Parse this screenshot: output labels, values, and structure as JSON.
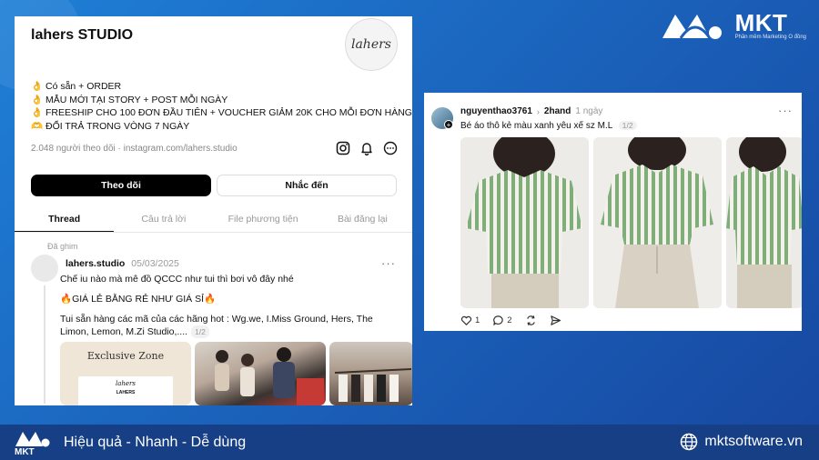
{
  "brand": {
    "name": "MKT",
    "tagline": "Phần mềm Marketing Ô đồng"
  },
  "profile": {
    "name": "lahers STUDIO",
    "avatar_text": "lahers",
    "bio": [
      "👌 Có sẵn + ORDER",
      "👌 MẪU MỚI TẠI STORY + POST MỖI NGÀY",
      "👌 FREESHIP CHO 100 ĐƠN ĐẦU TIÊN + VOUCHER GIẢM 20K CHO MỖI ĐƠN HÀNG",
      "🫶 ĐỔI TRẢ TRONG VÒNG 7 NGÀY"
    ],
    "followers_link": "2.048 người theo dõi · instagram.com/lahers.studio",
    "follow_label": "Theo dõi",
    "mention_label": "Nhắc đến",
    "tabs": [
      "Thread",
      "Câu trả lời",
      "File phương tiện",
      "Bài đăng lại"
    ]
  },
  "pinned_post": {
    "pinned_label": "Đã ghim",
    "username": "lahers.studio",
    "date": "05/03/2025",
    "line1": "Chế iu nào mà mê đồ QCCC như tui thì bơi vô đây nhé",
    "line2": "🔥GIÁ LẺ BẰNG RẺ NHƯ GIÁ SỈ🔥",
    "line3": "Tui sẵn hàng các mã của các hãng hot : Wg.we, I.Miss Ground, Hers, The Limon, Lemon, M.Zi Studio,....",
    "pager": "1/2",
    "thumb1_title": "Exclusive Zone",
    "thumb1_logo": "lahers",
    "thumb1_card": "LAHERS"
  },
  "listing_post": {
    "username": "nguyenthao3761",
    "category": "2hand",
    "time": "1 ngày",
    "text": "Bé áo thô kẻ màu xanh yêu xế sz M.L",
    "pager": "1/2",
    "likes": "1",
    "comments": "2"
  },
  "footer": {
    "logo_text": "MKT",
    "slogan": "Hiệu quả - Nhanh - Dễ dùng",
    "website": "mktsoftware.vn"
  },
  "colors": {
    "background": "#1a5fb8",
    "footer": "#173f86",
    "shirt_stripe": "#7fae7a"
  }
}
